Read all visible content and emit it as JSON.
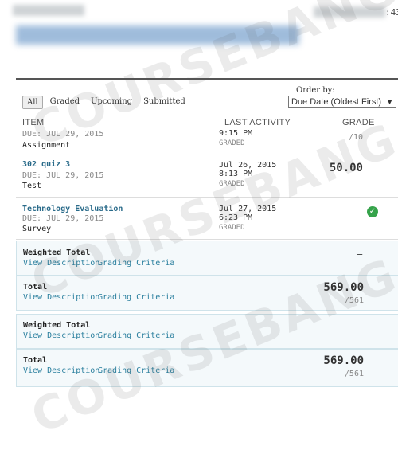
{
  "header": {
    "clock": ":43"
  },
  "filters": {
    "all": "All",
    "graded": "Graded",
    "upcoming": "Upcoming",
    "submitted": "Submitted"
  },
  "order_by": {
    "label": "Order by:",
    "selected": "Due Date (Oldest First)"
  },
  "columns": {
    "item": "ITEM",
    "last_activity": "LAST ACTIVITY",
    "grade": "GRADE"
  },
  "items": [
    {
      "due": "DUE: JUL 29, 2015",
      "type": "Assignment",
      "time": "9:15 PM",
      "status": "GRADED",
      "out_of": "/10"
    },
    {
      "name": "302 quiz 3",
      "due": "DUE: JUL 29, 2015",
      "type": "Test",
      "date": "Jul 26, 2015",
      "time": "8:13 PM",
      "status": "GRADED",
      "grade": "50.00"
    },
    {
      "name": "Technology Evaluation",
      "due": "DUE: JUL 29, 2015",
      "type": "Survey",
      "date": "Jul 27, 2015",
      "time": "6:23 PM",
      "status": "GRADED"
    }
  ],
  "totals": [
    {
      "label": "Weighted Total",
      "link1": "View Description",
      "link2": "Grading Criteria",
      "grade": "–"
    },
    {
      "label": "Total",
      "link1": "View Description",
      "link2": "Grading Criteria",
      "grade": "569.00",
      "out_of": "/561"
    },
    {
      "label": "Weighted Total",
      "link1": "View Description",
      "link2": "Grading Criteria",
      "grade": "–"
    },
    {
      "label": "Total",
      "link1": "View Description",
      "link2": "Grading Criteria",
      "grade": "569.00",
      "out_of": "/561"
    }
  ],
  "watermark": "COURSEBANG",
  "colors": {
    "link": "#2a7f9e",
    "check": "#35a34a"
  }
}
